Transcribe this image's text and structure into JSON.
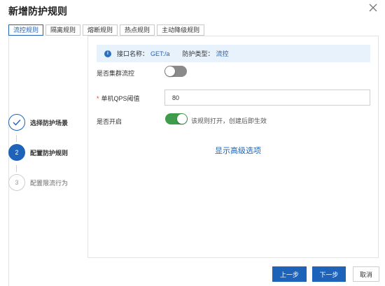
{
  "dialog": {
    "title": "新增防护规则",
    "close_icon": "close-icon"
  },
  "tabs": [
    {
      "label": "流控规则",
      "active": true
    },
    {
      "label": "隔离规则",
      "active": false
    },
    {
      "label": "熔断规则",
      "active": false
    },
    {
      "label": "热点规则",
      "active": false
    },
    {
      "label": "主动降级规则",
      "active": false
    }
  ],
  "steps": [
    {
      "number": "1",
      "label": "选择防护场景",
      "state": "done",
      "icon": "check-icon"
    },
    {
      "number": "2",
      "label": "配置防护规则",
      "state": "current"
    },
    {
      "number": "3",
      "label": "配置限流行为",
      "state": "pending"
    }
  ],
  "info": {
    "icon": "info-icon",
    "api_name_label": "接口名称：",
    "api_name_value": "GET:/a",
    "type_label": "防护类型：",
    "type_value": "流控"
  },
  "form": {
    "cluster_label": "是否集群流控",
    "cluster_enabled": false,
    "qps_required_mark": "*",
    "qps_label": "单机QPS阈值",
    "qps_value": "80",
    "enable_label": "是否开启",
    "enable_enabled": true,
    "enable_hint": "该规则打开，创建后即生效"
  },
  "advanced_link": "显示高级选项",
  "footer": {
    "prev_label": "上一步",
    "next_label": "下一步",
    "cancel_label": "取消"
  },
  "colors": {
    "primary": "#1d63ba",
    "switch_on": "#3f9c4b",
    "switch_off": "#8a8a8a",
    "info_bg": "#e8f2fc"
  }
}
